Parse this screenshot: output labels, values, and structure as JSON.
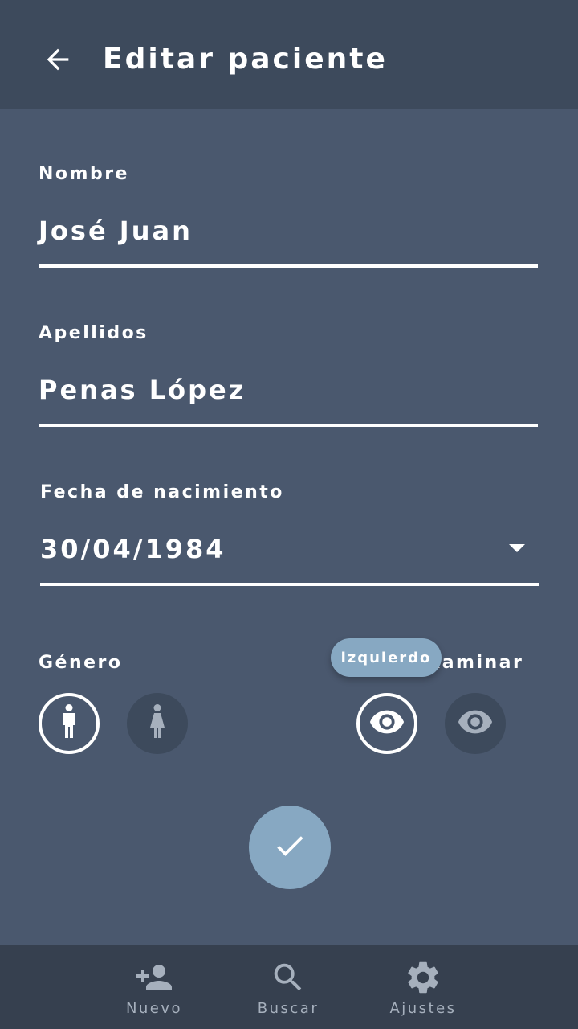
{
  "header": {
    "title": "Editar paciente",
    "back_icon": "arrow-back-icon"
  },
  "form": {
    "nombre": {
      "label": "Nombre",
      "value": "José Juan"
    },
    "apellidos": {
      "label": "Apellidos",
      "value": "Penas López"
    },
    "fecha": {
      "label": "Fecha de nacimiento",
      "value": "30/04/1984",
      "icon": "dropdown-arrow-icon"
    },
    "genero": {
      "label": "Género",
      "options": [
        {
          "icon": "male-icon",
          "selected": true
        },
        {
          "icon": "female-icon",
          "selected": false
        }
      ]
    },
    "examinar": {
      "label": "Ojo a examinar",
      "visible_label": "xaminar",
      "tooltip": "izquierdo",
      "options": [
        {
          "icon": "eye-icon",
          "selected": true
        },
        {
          "icon": "eye-icon",
          "selected": false
        }
      ]
    }
  },
  "submit_icon": "check-icon",
  "bottom_nav": {
    "items": [
      {
        "label": "Nuevo",
        "icon": "person-add-icon"
      },
      {
        "label": "Buscar",
        "icon": "search-icon"
      },
      {
        "label": "Ajustes",
        "icon": "settings-icon"
      }
    ]
  },
  "colors": {
    "background": "#4a586e",
    "appbar": "#3d4a5c",
    "accent": "#87a8c2",
    "bottom_nav": "#36404f",
    "nav_text": "#a6b0bd"
  }
}
